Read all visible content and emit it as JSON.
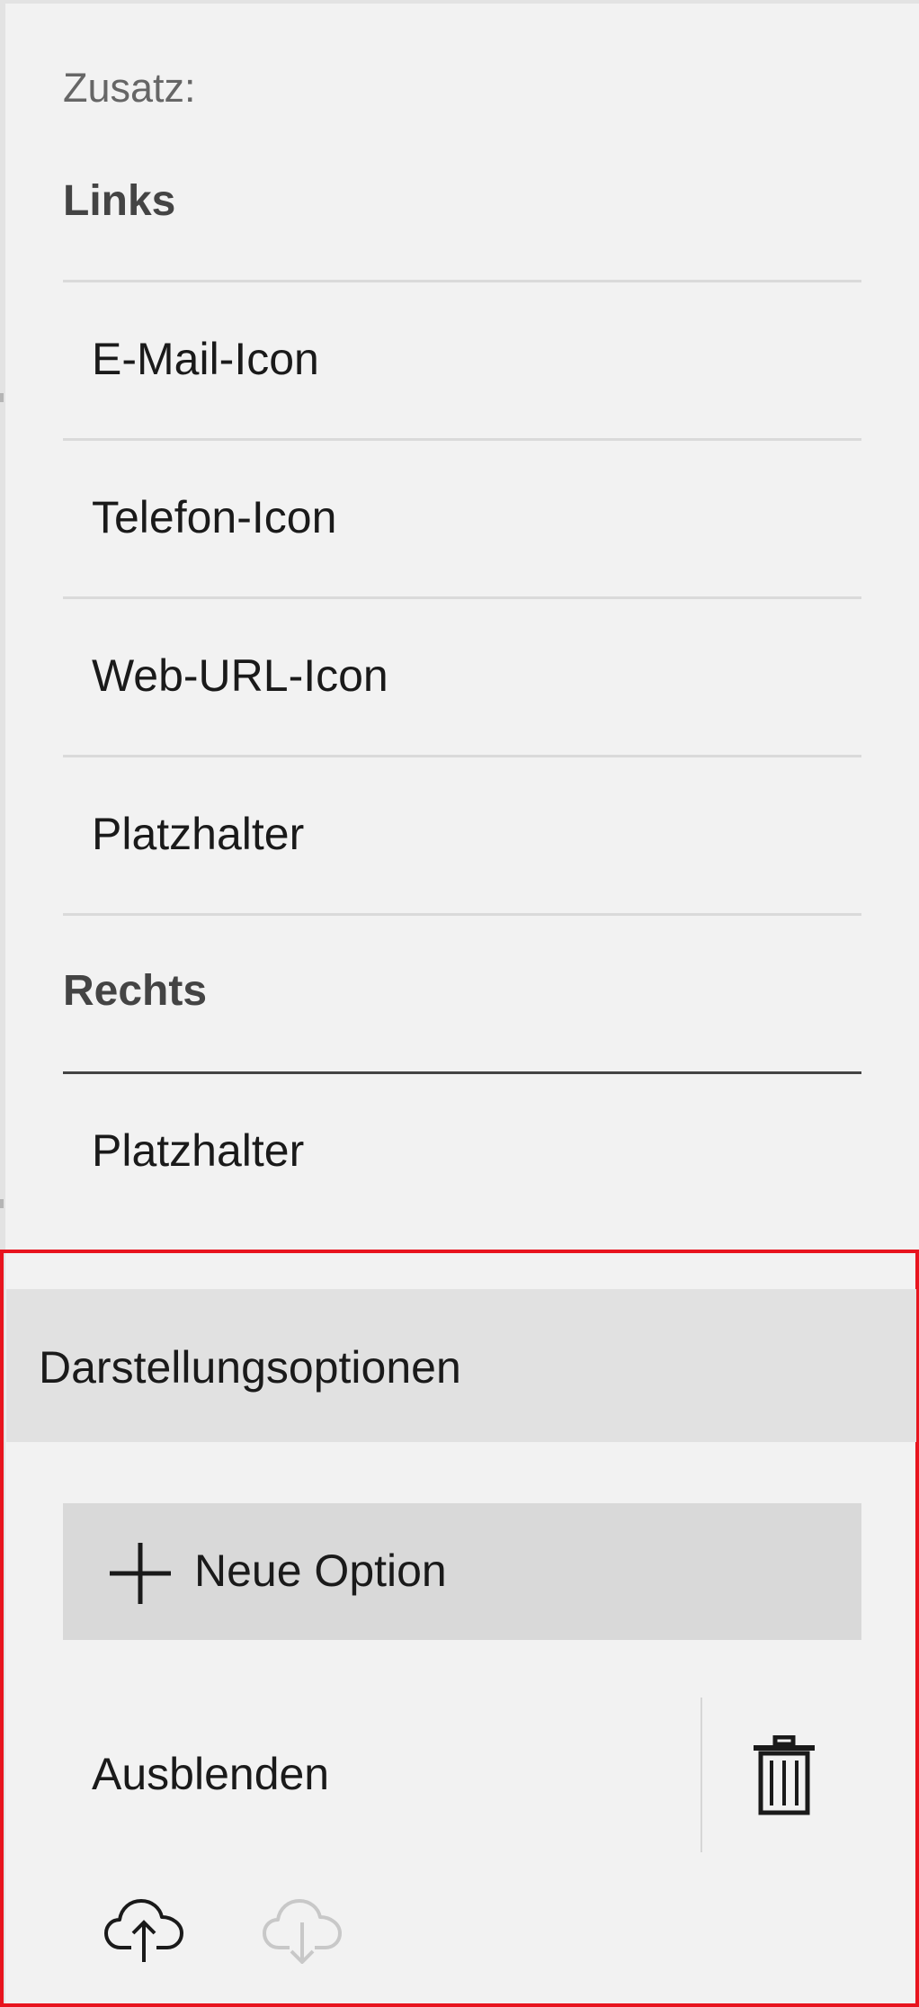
{
  "header": {
    "label": "Zusatz:"
  },
  "groups": {
    "links": {
      "heading": "Links",
      "items": [
        "E-Mail-Icon",
        "Telefon-Icon",
        "Web-URL-Icon",
        "Platzhalter"
      ]
    },
    "rechts": {
      "heading": "Rechts",
      "items": [
        "Platzhalter"
      ]
    }
  },
  "options": {
    "title": "Darstellungsoptionen",
    "new_option_label": "Neue Option",
    "entries": [
      {
        "label": "Ausblenden",
        "action_icon": "trash-icon"
      }
    ],
    "footer_icons": [
      "cloud-upload-icon",
      "cloud-download-icon"
    ],
    "colors": {
      "highlight_border": "#e8141e",
      "header_bg": "#e1e1e1",
      "button_bg": "#d9d9d9"
    }
  }
}
